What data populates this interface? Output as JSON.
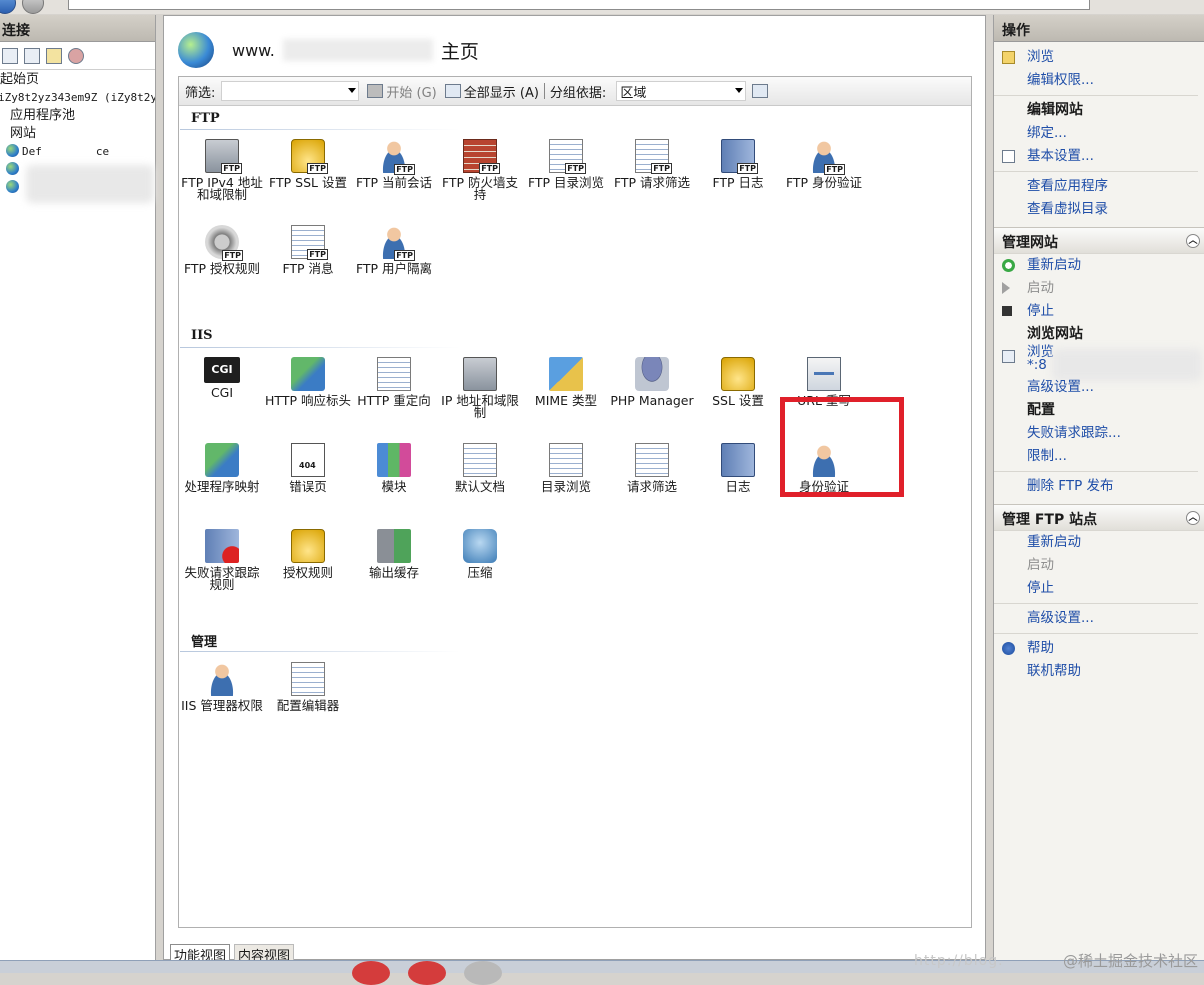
{
  "left_pane": {
    "header": "连接",
    "tree": [
      "起始页",
      "iZy8t2yz343em9Z (iZy8t2y",
      "应用程序池",
      "网站",
      "Def",
      "ce"
    ]
  },
  "center": {
    "title_prefix": "www.",
    "title_suffix": "主页",
    "filter": {
      "label": "筛选:",
      "start_btn": "开始 (G)",
      "show_all_btn": "全部显示 (A)",
      "group_label": "分组依据:",
      "group_value": "区域"
    },
    "sections": {
      "ftp": "FTP",
      "iis": "IIS",
      "mgmt": "管理"
    },
    "ftp_items": [
      "FTP IPv4 地址和域限制",
      "FTP SSL 设置",
      "FTP 当前会话",
      "FTP 防火墙支持",
      "FTP 目录浏览",
      "FTP 请求筛选",
      "FTP 日志",
      "FTP 身份验证",
      "FTP 授权规则",
      "FTP 消息",
      "FTP 用户隔离"
    ],
    "ftp_tag": "FTP",
    "cgi_badge": "CGI",
    "iis_items": [
      "CGI",
      "HTTP 响应标头",
      "HTTP 重定向",
      "IP 地址和域限制",
      "MIME 类型",
      "PHP Manager",
      "SSL 设置",
      "URL 重写",
      "处理程序映射",
      "错误页",
      "模块",
      "默认文档",
      "目录浏览",
      "请求筛选",
      "日志",
      "身份验证",
      "失败请求跟踪规则",
      "授权规则",
      "输出缓存",
      "压缩"
    ],
    "mgmt_items": [
      "IIS 管理器权限",
      "配置编辑器"
    ],
    "bottom_tabs": {
      "features": "功能视图",
      "content": "内容视图"
    }
  },
  "actions": {
    "header": "操作",
    "browse": "浏览",
    "edit_perms": "编辑权限...",
    "edit_site_hdr": "编辑网站",
    "bindings": "绑定...",
    "basic_settings": "基本设置...",
    "view_apps": "查看应用程序",
    "view_vdirs": "查看虚拟目录",
    "manage_site_hdr": "管理网站",
    "restart": "重新启动",
    "start": "启动",
    "stop": "停止",
    "browse_site_hdr": "浏览网站",
    "browse_item_line1": "浏览",
    "browse_item_line2": "*:8",
    "advanced": "高级设置...",
    "config_hdr": "配置",
    "failed_trace": "失败请求跟踪...",
    "limits": "限制...",
    "remove_ftp": "删除 FTP 发布",
    "manage_ftp_hdr": "管理 FTP 站点",
    "ftp_restart": "重新启动",
    "ftp_start": "启动",
    "ftp_stop": "停止",
    "ftp_advanced": "高级设置...",
    "help": "帮助",
    "online_help": "联机帮助"
  },
  "watermark": "@稀土掘金技术社区",
  "watermark_url": "http://blog."
}
